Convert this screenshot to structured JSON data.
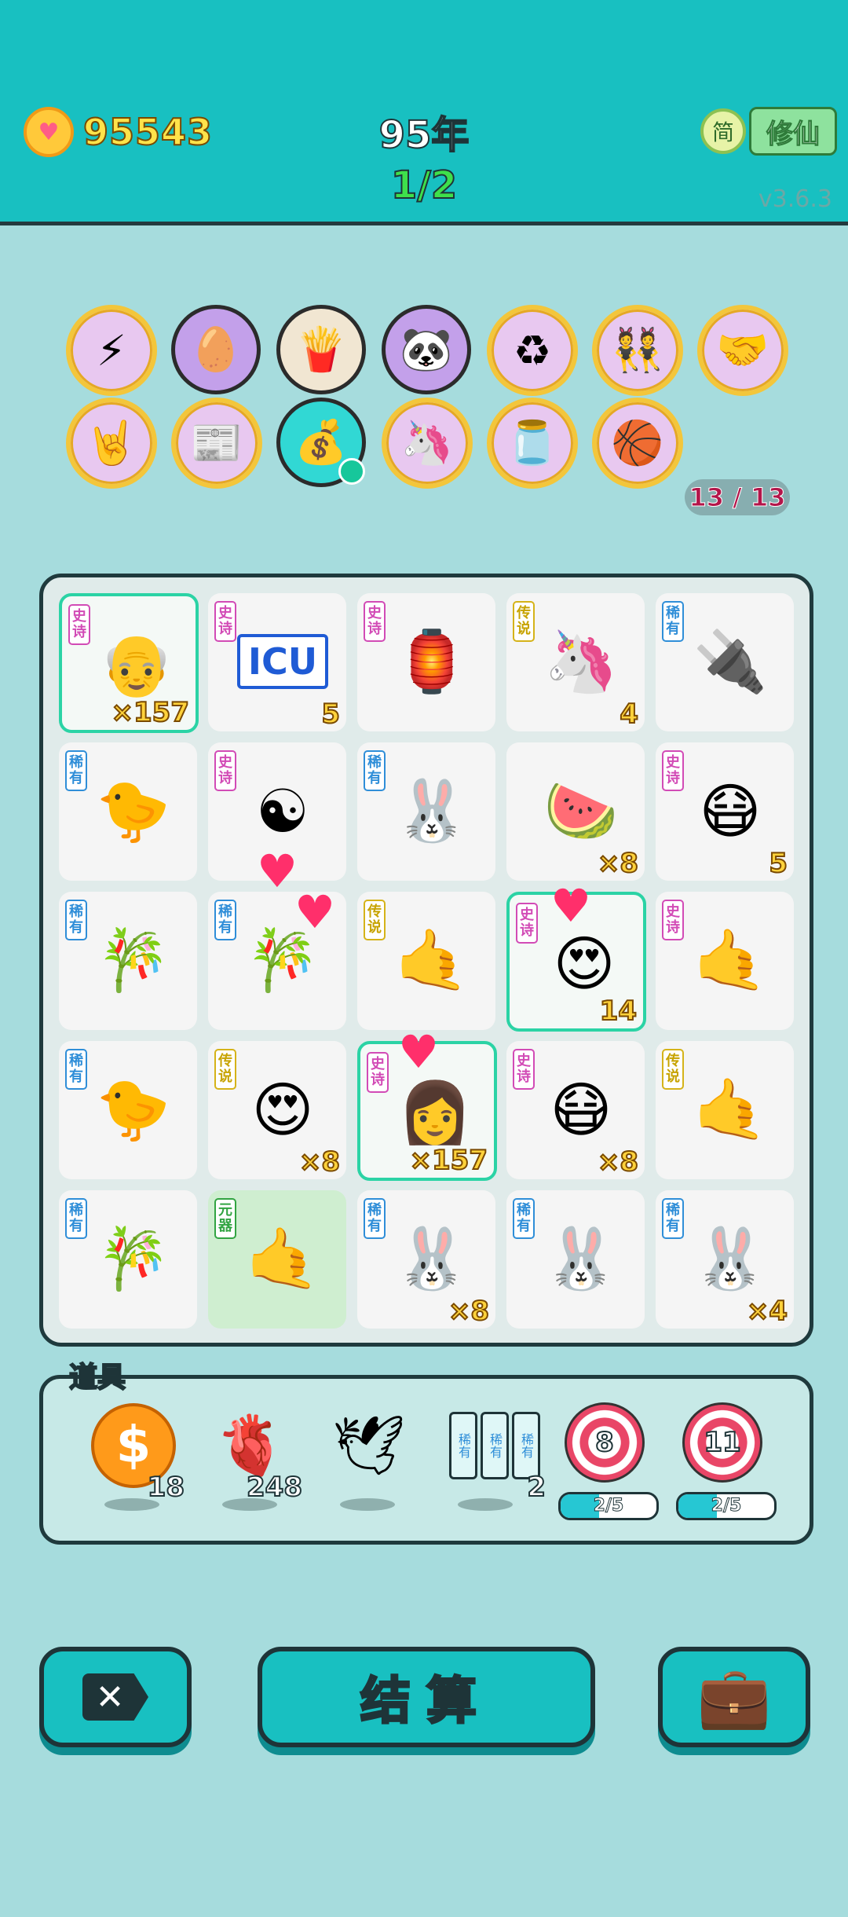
{
  "header": {
    "coins": "95543",
    "year": "95年",
    "page": "1/2",
    "jian_label": "简",
    "xiuxian_label": "修仙",
    "version": "v3.6.3"
  },
  "achievements": {
    "counter": "13 / 13",
    "badges": [
      {
        "name": "lightning",
        "icon": "⚡"
      },
      {
        "name": "egg",
        "icon": "🥚"
      },
      {
        "name": "fries",
        "icon": "🍟"
      },
      {
        "name": "panda",
        "icon": "🐼"
      },
      {
        "name": "recycle",
        "icon": "♻"
      },
      {
        "name": "twins",
        "icon": "👯"
      },
      {
        "name": "handshake",
        "icon": "🤝"
      },
      {
        "name": "rock-hand",
        "icon": "🤘"
      },
      {
        "name": "time-magazine",
        "icon": "📰"
      },
      {
        "name": "money-bag",
        "icon": "💰"
      },
      {
        "name": "unicorn",
        "icon": "🦄"
      },
      {
        "name": "jar",
        "icon": "🫙"
      },
      {
        "name": "basketballs",
        "icon": "🏀"
      }
    ]
  },
  "board": {
    "tiles": [
      {
        "tag": "史诗",
        "rarity": "epic",
        "icon": "👴",
        "count": "×157"
      },
      {
        "tag": "史诗",
        "rarity": "epic",
        "icon": "ICU",
        "count": "5"
      },
      {
        "tag": "史诗",
        "rarity": "epic",
        "icon": "🏮",
        "count": ""
      },
      {
        "tag": "传说",
        "rarity": "legend",
        "icon": "🦄",
        "count": "4"
      },
      {
        "tag": "稀有",
        "rarity": "rare",
        "icon": "🔌",
        "count": ""
      },
      {
        "tag": "稀有",
        "rarity": "rare",
        "icon": "🐤",
        "count": ""
      },
      {
        "tag": "史诗",
        "rarity": "epic",
        "icon": "☯",
        "count": ""
      },
      {
        "tag": "稀有",
        "rarity": "rare",
        "icon": "🐰",
        "count": ""
      },
      {
        "tag": "",
        "rarity": "none",
        "icon": "🍉",
        "count": "×8"
      },
      {
        "tag": "史诗",
        "rarity": "epic",
        "icon": "😷",
        "count": "5"
      },
      {
        "tag": "稀有",
        "rarity": "rare",
        "icon": "🎋",
        "count": ""
      },
      {
        "tag": "稀有",
        "rarity": "rare",
        "icon": "🎋",
        "count": ""
      },
      {
        "tag": "传说",
        "rarity": "legend",
        "icon": "🤙",
        "count": ""
      },
      {
        "tag": "史诗",
        "rarity": "epic",
        "icon": "😍",
        "count": "14"
      },
      {
        "tag": "史诗",
        "rarity": "epic",
        "icon": "🤙",
        "count": ""
      },
      {
        "tag": "稀有",
        "rarity": "rare",
        "icon": "🐤",
        "count": ""
      },
      {
        "tag": "传说",
        "rarity": "legend",
        "icon": "😍",
        "count": "×8"
      },
      {
        "tag": "史诗",
        "rarity": "epic",
        "icon": "👩",
        "count": "×157"
      },
      {
        "tag": "史诗",
        "rarity": "epic",
        "icon": "😷",
        "count": "×8"
      },
      {
        "tag": "传说",
        "rarity": "legend",
        "icon": "🤙",
        "count": ""
      },
      {
        "tag": "稀有",
        "rarity": "rare",
        "icon": "🎋",
        "count": ""
      },
      {
        "tag": "元器",
        "rarity": "basic",
        "icon": "🤙",
        "count": ""
      },
      {
        "tag": "稀有",
        "rarity": "rare",
        "icon": "🐰",
        "count": "×8"
      },
      {
        "tag": "稀有",
        "rarity": "rare",
        "icon": "🐰",
        "count": ""
      },
      {
        "tag": "稀有",
        "rarity": "rare",
        "icon": "🐰",
        "count": "×4"
      }
    ]
  },
  "items": {
    "label": "道具",
    "coin_count": "18",
    "liver_count": "248",
    "pigeon_count": "",
    "cards_count": "2",
    "cards_labels": [
      "稀有",
      "稀有",
      "稀有"
    ],
    "target1_value": "8",
    "target1_progress": "2/5",
    "target1_fraction": 0.4,
    "target2_value": "11",
    "target2_progress": "2/5",
    "target2_fraction": 0.4
  },
  "actions": {
    "close_icon": "✕",
    "settle_label": "结算",
    "bag_icon": "💼"
  }
}
